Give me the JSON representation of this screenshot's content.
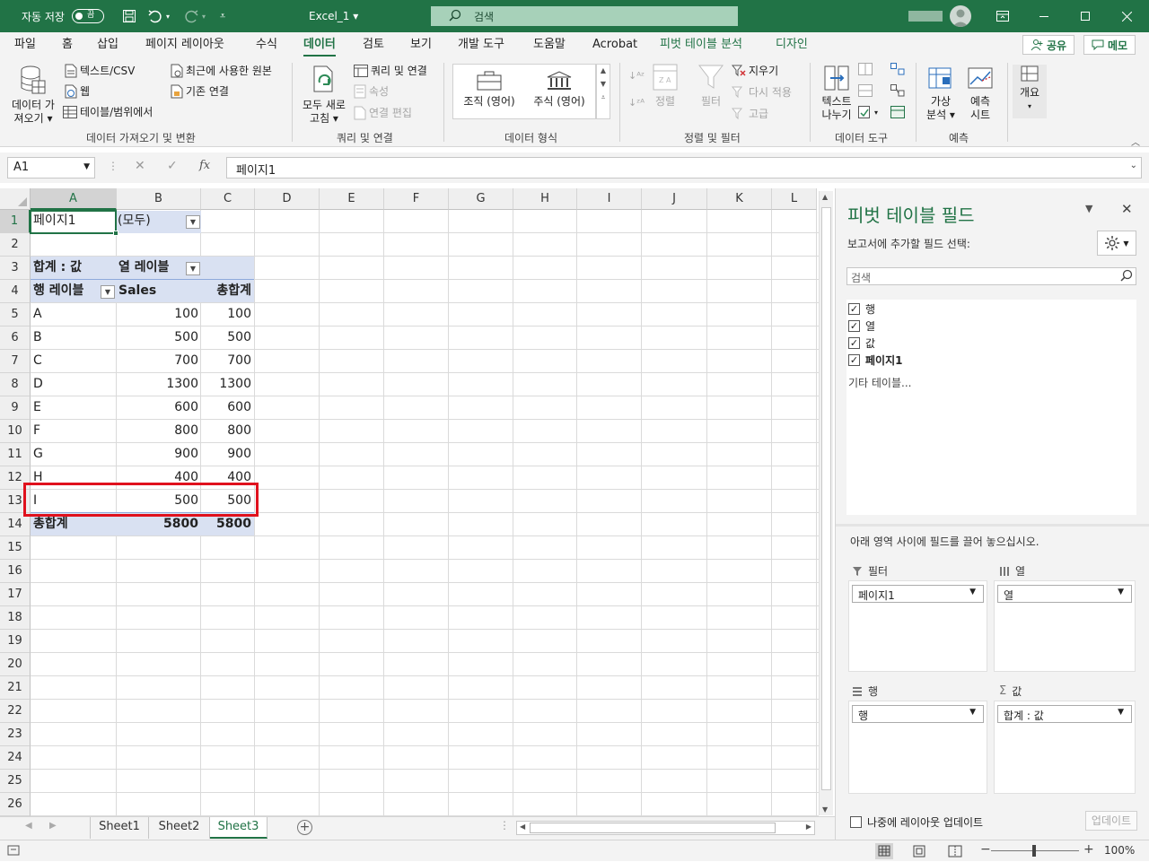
{
  "titlebar": {
    "autosave_label": "자동 저장",
    "autosave_state": "끔",
    "filename": "Excel_1 ▾",
    "search_placeholder": "검색"
  },
  "tabs": {
    "file": "파일",
    "home": "홈",
    "insert": "삽입",
    "layout": "페이지 레이아웃",
    "formulas": "수식",
    "data": "데이터",
    "review": "검토",
    "view": "보기",
    "developer": "개발 도구",
    "help": "도움말",
    "acrobat": "Acrobat",
    "pivot_analyze": "피벗 테이블 분석",
    "design": "디자인",
    "share": "공유",
    "comments": "메모"
  },
  "ribbon": {
    "get_data": "데이터 가\n져오기 ▾",
    "text_csv": "텍스트/CSV",
    "web": "웹",
    "from_table": "테이블/범위에서",
    "recent_sources": "최근에 사용한 원본",
    "existing_conn": "기존 연결",
    "group_get": "데이터 가져오기 및 변환",
    "refresh_all": "모두 새로\n고침 ▾",
    "queries_conn": "쿼리 및 연결",
    "properties": "속성",
    "edit_links": "연결 편집",
    "group_queries": "쿼리 및 연결",
    "org": "조직 (영어)",
    "stocks": "주식 (영어)",
    "group_types": "데이터 형식",
    "sort": "정렬",
    "filter": "필터",
    "clear": "지우기",
    "reapply": "다시 적용",
    "advanced": "고급",
    "group_sort": "정렬 및 필터",
    "text_to_cols": "텍스트\n나누기",
    "group_tools": "데이터 도구",
    "what_if": "가상\n분석 ▾",
    "forecast": "예측\n시트",
    "group_forecast": "예측",
    "outline": "개요"
  },
  "formula_bar": {
    "name_box": "A1",
    "formula": "페이지1"
  },
  "grid": {
    "columns": [
      "A",
      "B",
      "C",
      "D",
      "E",
      "F",
      "G",
      "H",
      "I",
      "J",
      "K",
      "L"
    ],
    "rows": [
      "1",
      "2",
      "3",
      "4",
      "5",
      "6",
      "7",
      "8",
      "9",
      "10",
      "11",
      "12",
      "13",
      "14",
      "15",
      "16",
      "17",
      "18",
      "19",
      "20",
      "21",
      "22",
      "23",
      "24",
      "25",
      "26"
    ],
    "a1": "페이지1",
    "b1": "(모두)",
    "a3": "합계 : 값",
    "b3": "열 레이블",
    "a4": "행 레이블",
    "b4": "Sales",
    "c4": "총합계",
    "pivot_rows": [
      {
        "label": "A",
        "sales": "100",
        "total": "100"
      },
      {
        "label": "B",
        "sales": "500",
        "total": "500"
      },
      {
        "label": "C",
        "sales": "700",
        "total": "700"
      },
      {
        "label": "D",
        "sales": "1300",
        "total": "1300"
      },
      {
        "label": "E",
        "sales": "600",
        "total": "600"
      },
      {
        "label": "F",
        "sales": "800",
        "total": "800"
      },
      {
        "label": "G",
        "sales": "900",
        "total": "900"
      },
      {
        "label": "H",
        "sales": "400",
        "total": "400"
      },
      {
        "label": "I",
        "sales": "500",
        "total": "500"
      }
    ],
    "grand_label": "총합계",
    "grand_sales": "5800",
    "grand_total": "5800"
  },
  "sheets": {
    "tabs": [
      "Sheet1",
      "Sheet2",
      "Sheet3"
    ],
    "active": "Sheet3"
  },
  "status": {
    "zoom": "100%"
  },
  "pane": {
    "title": "피벗 테이블 필드",
    "subtitle": "보고서에 추가할 필드 선택:",
    "search_placeholder": "검색",
    "fields": [
      "행",
      "열",
      "값",
      "페이지1"
    ],
    "more_tables": "기타 테이블...",
    "drag_hint": "아래 영역 사이에 필드를 끌어 놓으십시오.",
    "filter_label": "필터",
    "filter_value": "페이지1",
    "columns_label": "열",
    "columns_value": "열",
    "rows_label": "행",
    "rows_value": "행",
    "values_label": "값",
    "values_value": "합계 : 값",
    "defer_label": "나중에 레이아웃 업데이트",
    "update_button": "업데이트"
  },
  "colors": {
    "accent": "#217346",
    "pivot_header": "#d9e1f2",
    "highlight": "#e0111d"
  }
}
